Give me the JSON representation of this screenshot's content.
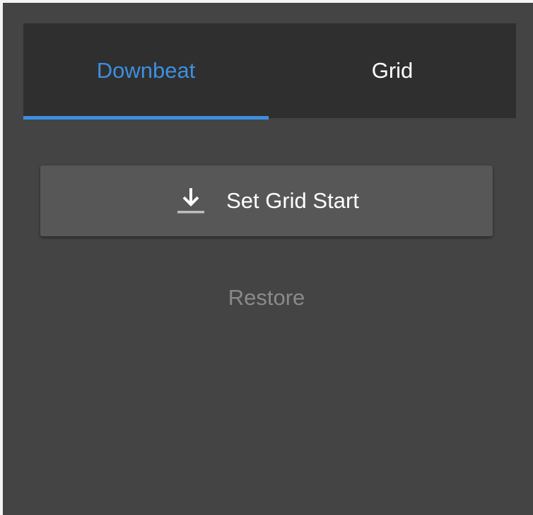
{
  "tabs": [
    {
      "label": "Downbeat",
      "active": true
    },
    {
      "label": "Grid",
      "active": false
    }
  ],
  "actions": {
    "set_grid_start_label": "Set Grid Start",
    "set_grid_start_icon": "download-icon",
    "restore_label": "Restore"
  },
  "colors": {
    "accent": "#3d8fe0",
    "background": "#444444",
    "tab_bar": "#2f2f2f",
    "button": "#575757",
    "disabled_text": "#8a8a8a"
  }
}
